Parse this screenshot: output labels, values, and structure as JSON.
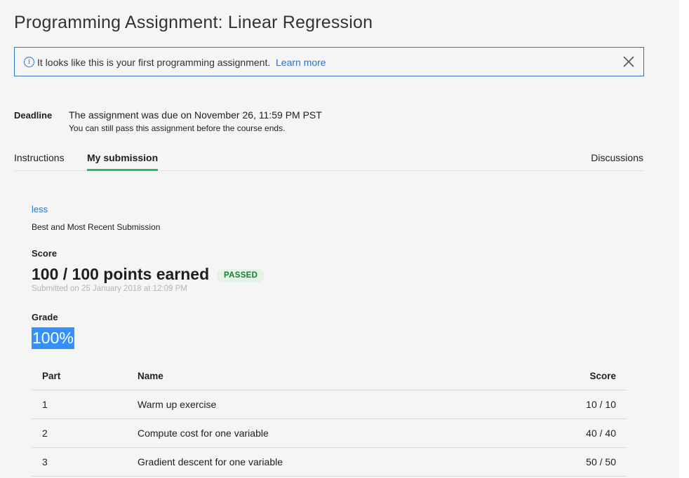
{
  "page": {
    "title": "Programming Assignment: Linear Regression"
  },
  "banner": {
    "info_icon": "info-icon",
    "message": "It looks like this is your first programming assignment.",
    "learn_more": "Learn more",
    "close_icon": "close-icon"
  },
  "deadline": {
    "label": "Deadline",
    "main": "The assignment was due on November 26, 11:59 PM PST",
    "sub": "You can still pass this assignment before the course ends."
  },
  "tabs": [
    {
      "label": "Instructions",
      "active": false
    },
    {
      "label": "My submission",
      "active": true
    },
    {
      "label": "Discussions",
      "active": false
    }
  ],
  "submission": {
    "less_link": "less",
    "best_label": "Best and Most Recent Submission",
    "score_label": "Score",
    "points": "100 / 100 points earned",
    "status_badge": "PASSED",
    "submitted": "Submitted on 25 January 2018 at 12:09 PM",
    "grade_label": "Grade",
    "grade": "100%"
  },
  "parts_table": {
    "headers": {
      "part": "Part",
      "name": "Name",
      "score": "Score"
    },
    "rows": [
      {
        "part": "1",
        "name": "Warm up exercise",
        "score": "10 / 10"
      },
      {
        "part": "2",
        "name": "Compute cost for one variable",
        "score": "40 / 40"
      },
      {
        "part": "3",
        "name": "Gradient descent for one variable",
        "score": "50 / 50"
      }
    ]
  },
  "colors": {
    "accent": "#2a73cc",
    "tab_underline": "#29b86b",
    "passed_bg": "#e3f4e6",
    "passed_text": "#1f7a3a",
    "selection": "#3390ff"
  }
}
